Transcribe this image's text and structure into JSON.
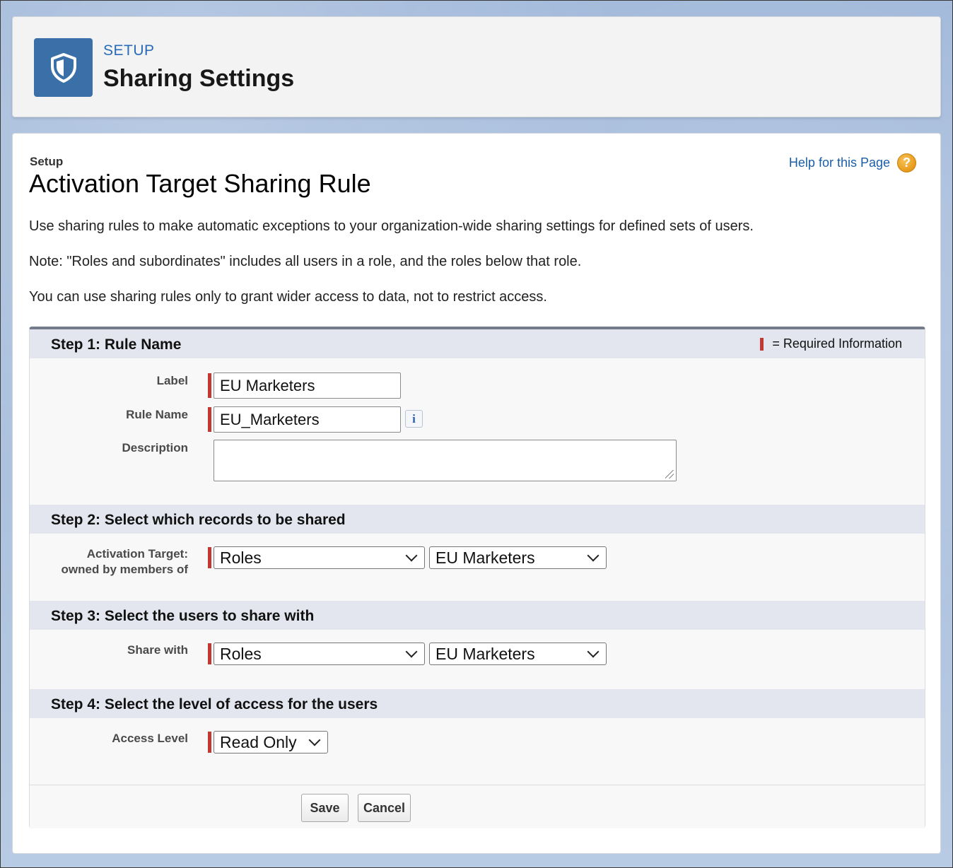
{
  "header": {
    "eyebrow": "SETUP",
    "title": "Sharing Settings"
  },
  "page": {
    "breadcrumb": "Setup",
    "title": "Activation Target Sharing Rule",
    "help_link": "Help for this Page",
    "intro": [
      "Use sharing rules to make automatic exceptions to your organization-wide sharing settings for defined sets of users.",
      "Note: \"Roles and subordinates\" includes all users in a role, and the roles below that role.",
      "You can use sharing rules only to grant wider access to data, not to restrict access."
    ]
  },
  "step1": {
    "title": "Step 1: Rule Name",
    "required_note": "= Required Information",
    "label_label": "Label",
    "label_value": "EU Marketers",
    "rule_name_label": "Rule Name",
    "rule_name_value": "EU_Marketers",
    "info_glyph": "i",
    "description_label": "Description",
    "description_value": ""
  },
  "step2": {
    "title": "Step 2: Select which records to be shared",
    "label_line1": "Activation Target:",
    "label_line2": "owned by members of",
    "type_value": "Roles",
    "group_value": "EU Marketers"
  },
  "step3": {
    "title": "Step 3: Select the users to share with",
    "label": "Share with",
    "type_value": "Roles",
    "group_value": "EU Marketers"
  },
  "step4": {
    "title": "Step 4: Select the level of access for the users",
    "label": "Access Level",
    "access_value": "Read Only"
  },
  "buttons": {
    "save": "Save",
    "cancel": "Cancel"
  },
  "icons": {
    "header": "shield-icon",
    "help": "help-question-icon"
  },
  "colors": {
    "brand_blue": "#3b6fa8",
    "required_red": "#c23934",
    "link_blue": "#1a5ea8"
  }
}
